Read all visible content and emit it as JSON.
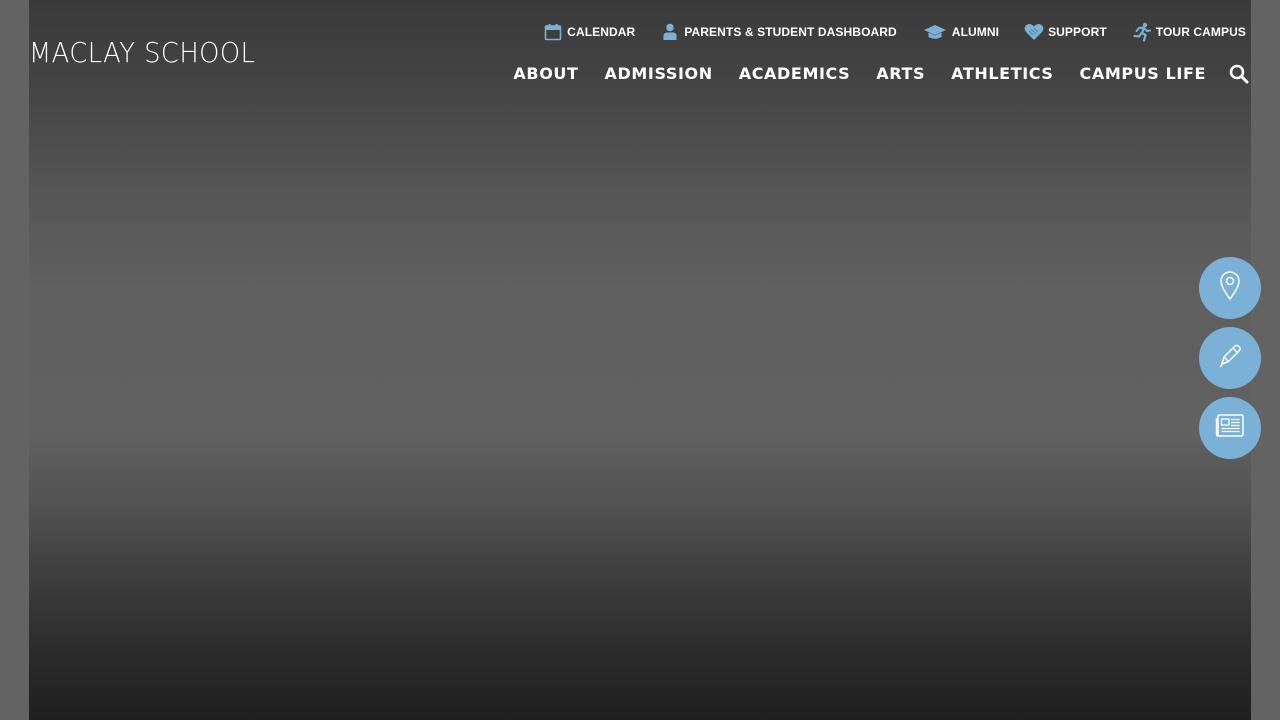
{
  "site": {
    "logo_text": "MACLAY SCHOOL"
  },
  "utility_nav": [
    {
      "label": "CALENDAR",
      "icon": "calendar-icon"
    },
    {
      "label": "PARENTS & STUDENT DASHBOARD",
      "icon": "person-icon"
    },
    {
      "label": "ALUMNI",
      "icon": "graduation-cap-icon"
    },
    {
      "label": "SUPPORT",
      "icon": "heart-icon"
    },
    {
      "label": "TOUR CAMPUS",
      "icon": "running-person-icon"
    }
  ],
  "main_nav": [
    {
      "label": "ABOUT"
    },
    {
      "label": "ADMISSION"
    },
    {
      "label": "ACADEMICS"
    },
    {
      "label": "ARTS"
    },
    {
      "label": "ATHLETICS"
    },
    {
      "label": "CAMPUS LIFE"
    }
  ],
  "search": {
    "icon": "search-icon"
  },
  "quick_links": [
    {
      "icon": "map-pin-icon"
    },
    {
      "icon": "pencil-icon"
    },
    {
      "icon": "newspaper-icon"
    }
  ],
  "colors": {
    "accent": "#7bb1d6",
    "text": "#ffffff",
    "hero_mid": "#616161",
    "hero_dark": "#1f1f1f"
  }
}
